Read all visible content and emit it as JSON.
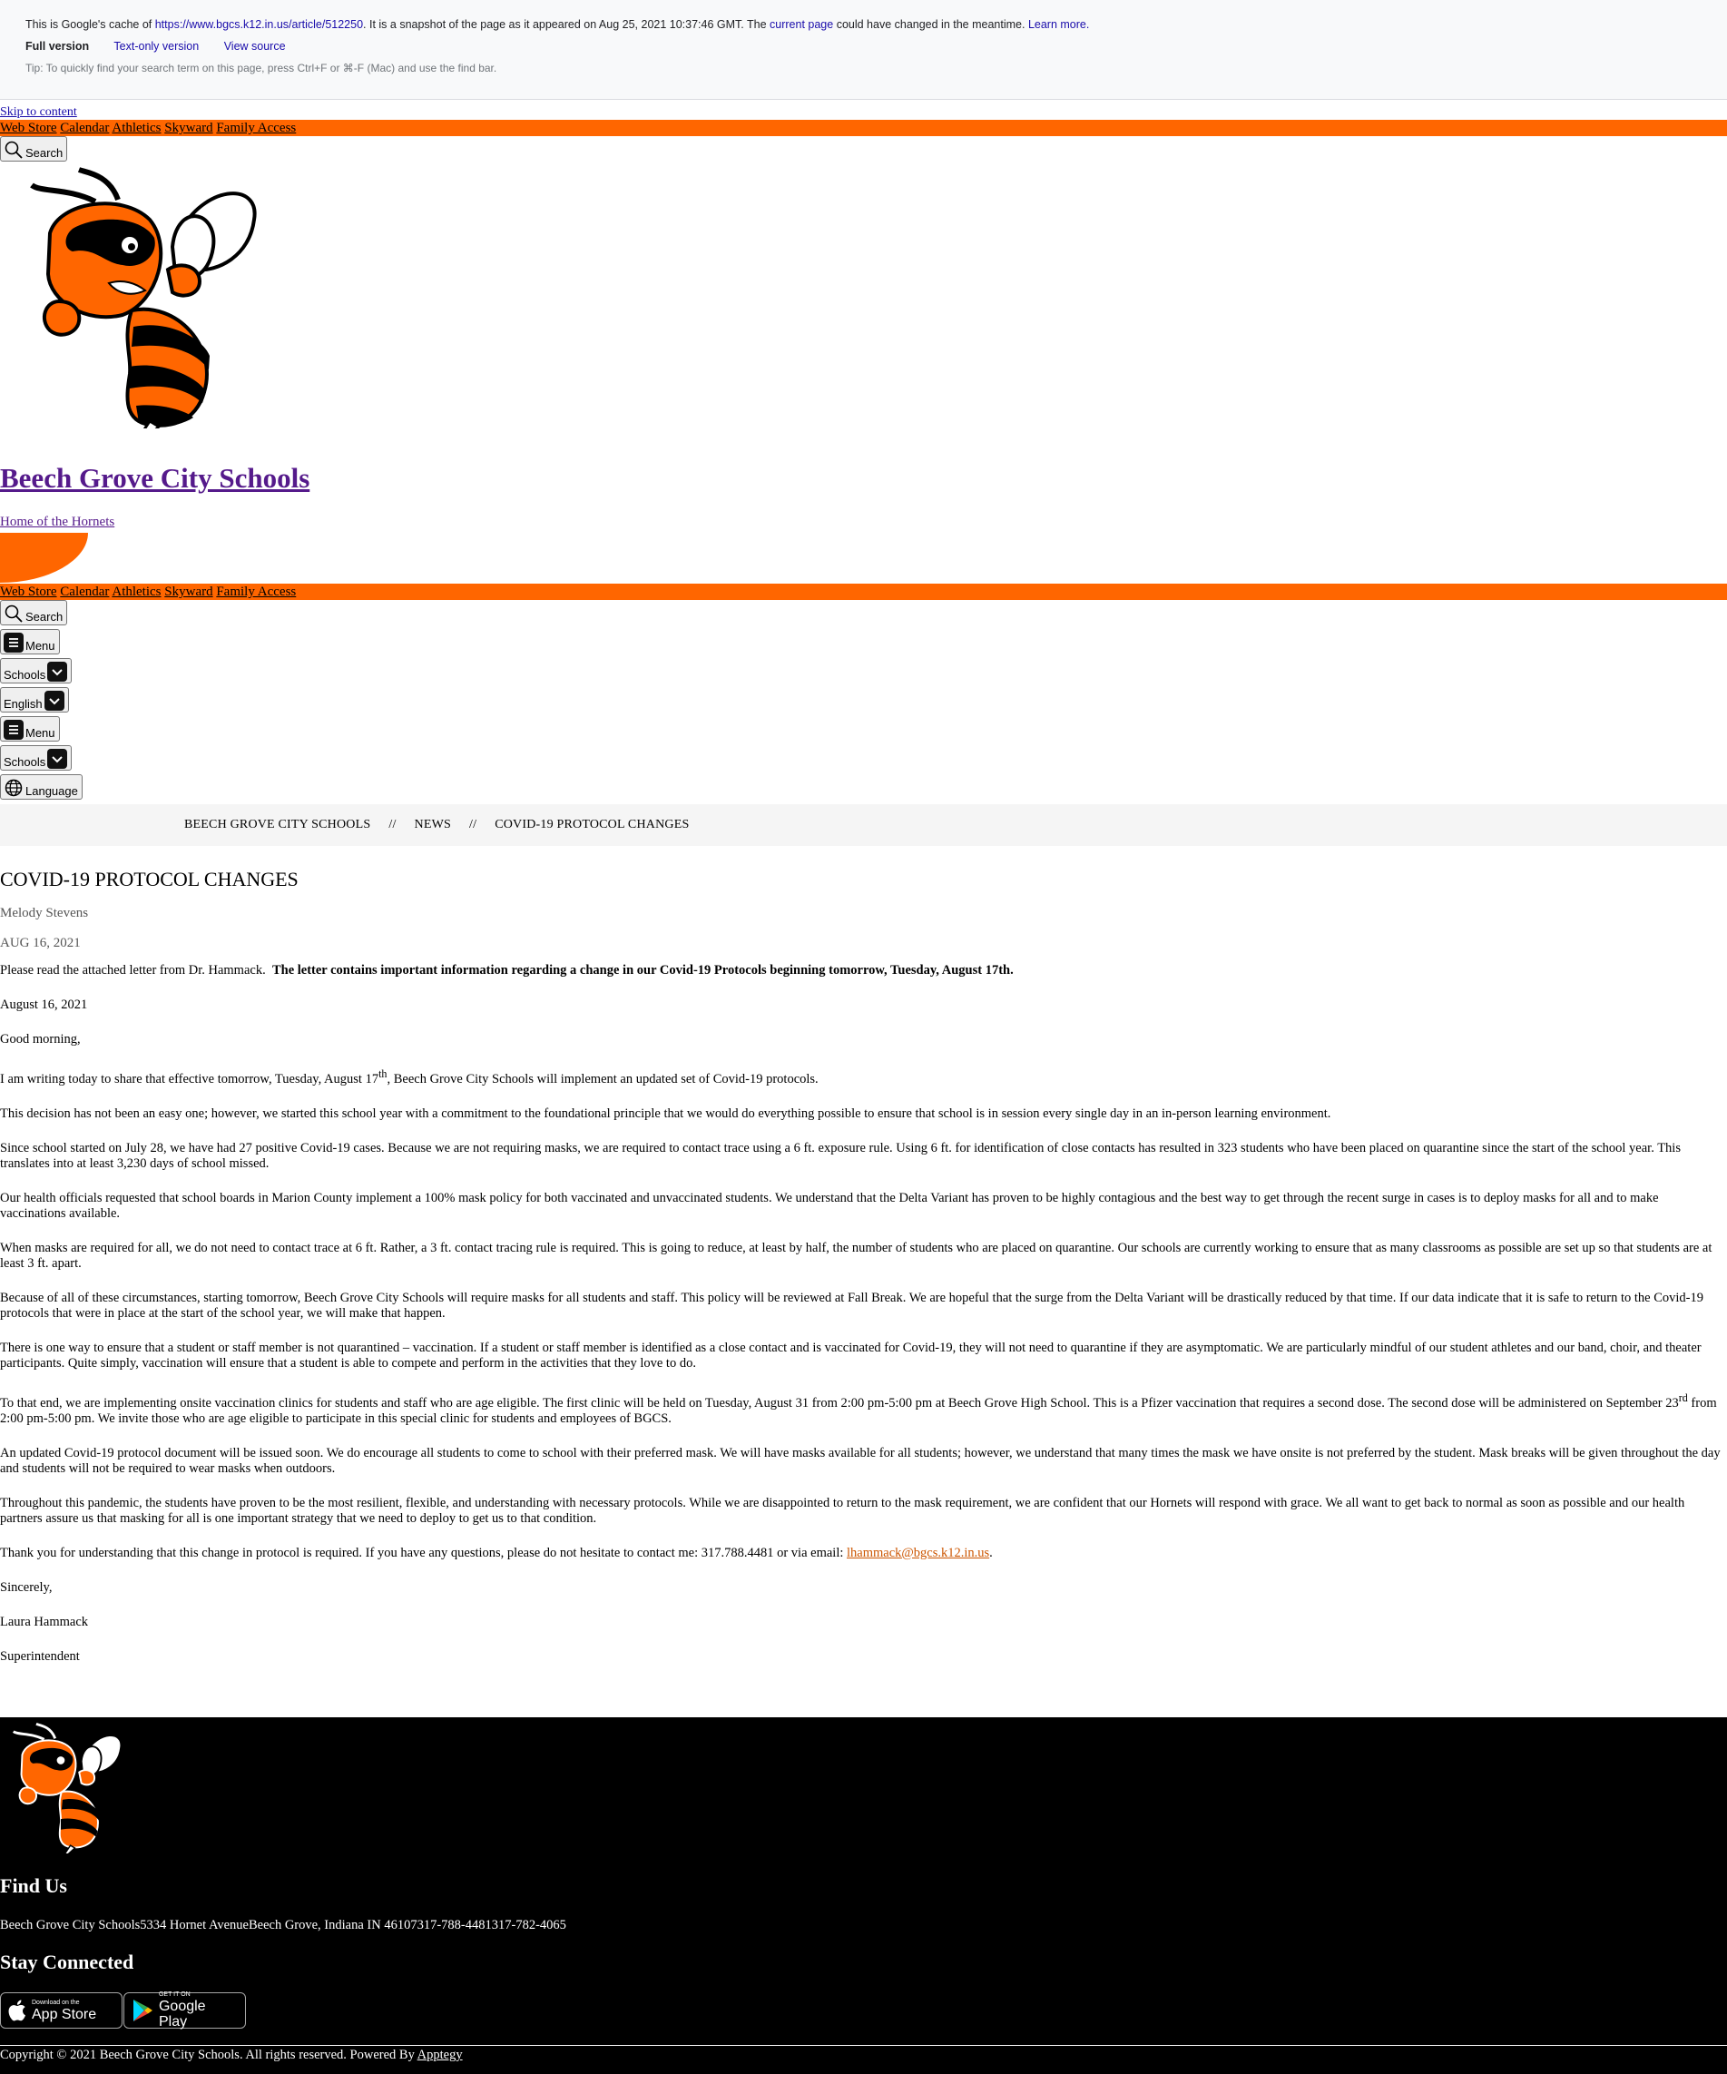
{
  "cache_banner": {
    "prefix": "This is Google's cache of ",
    "url": "https://www.bgcs.k12.in.us/article/512250",
    "mid": ". It is a snapshot of the page as it appeared on Aug 25, 2021 10:37:46 GMT. The ",
    "current_page": "current page",
    "suffix": " could have changed in the meantime. ",
    "learn_more": "Learn more.",
    "full_version": "Full version",
    "text_only": "Text-only version",
    "view_source": "View source",
    "tip": "Tip: To quickly find your search term on this page, press Ctrl+F or ⌘-F (Mac) and use the find bar."
  },
  "skip_link": "Skip to content",
  "top_nav": [
    "Web Store",
    "Calendar",
    "Athletics",
    "Skyward",
    "Family Access"
  ],
  "buttons": {
    "search": "Search",
    "menu": "Menu",
    "schools": "Schools",
    "english": "English",
    "language": "Language"
  },
  "site": {
    "title": "Beech Grove City Schools",
    "tagline": "Home of the Hornets"
  },
  "breadcrumb": [
    "BEECH GROVE CITY SCHOOLS",
    "NEWS",
    "COVID-19 PROTOCOL CHANGES"
  ],
  "breadcrumb_sep": "//",
  "article": {
    "title": "COVID-19 PROTOCOL CHANGES",
    "author": "Melody Stevens",
    "date": "AUG 16, 2021",
    "intro": "Please read the attached letter from Dr. Hammack.",
    "intro_bold": "The letter contains important information regarding a change in our Covid-19 Protocols beginning tomorrow, Tuesday, August 17th.",
    "letter_date": "August 16, 2021",
    "greeting": "Good morning,",
    "p1_a": "I am writing today to share that effective tomorrow, Tuesday, August 17",
    "p1_sup": "th",
    "p1_b": ", Beech Grove City Schools will implement an updated set of Covid-19 protocols.",
    "p2": "This decision has not been an easy one; however, we started this school year with a commitment to the foundational principle that we would do everything possible to ensure that school is in session every single day in an in-person learning environment.",
    "p3": "Since school started on July 28, we have had 27 positive Covid-19 cases.  Because we are not requiring masks, we are required to contact trace using a 6 ft. exposure rule.  Using 6 ft. for identification of close contacts has resulted in 323 students who have been placed on quarantine since the start of the school year.  This translates into at least 3,230 days of school missed.",
    "p4": "Our health officials requested that school boards in Marion County implement a 100% mask policy for both vaccinated and unvaccinated students.  We understand that the Delta Variant has proven to be highly contagious and the best way to get through the recent surge in cases is to deploy masks for all and to make vaccinations available.",
    "p5": "When masks are required for all, we do not need to contact trace at 6 ft.  Rather, a 3 ft. contact tracing rule is required.  This is going to reduce, at least by half, the number of students who are placed on quarantine.  Our schools are currently working to ensure that as many classrooms as possible are set up so that students are at least 3 ft. apart.",
    "p6": "Because of all of these circumstances, starting tomorrow, Beech Grove City Schools will require masks for all students and staff.  This policy will be reviewed at Fall Break.  We are hopeful that the surge from the Delta Variant will be drastically reduced by that time.  If our data indicate that it is safe to return to the Covid-19 protocols that were in place at the start of the school year, we will make that happen.",
    "p7": "There is one way to ensure that a student or staff member is not quarantined – vaccination. If a student or staff member is identified as a close contact and is vaccinated for Covid-19, they will not need to quarantine if they are asymptomatic.  We are particularly mindful of our student athletes and our band, choir, and theater participants.  Quite simply, vaccination will ensure that a student is able to compete and perform in the activities that they love to do.",
    "p8_a": "To that end, we are implementing onsite vaccination clinics for students and staff who are age eligible.  The first clinic will be held on Tuesday, August 31 from 2:00 pm-5:00 pm at Beech Grove High School.  This is a Pfizer vaccination that requires a second dose.  The second dose will be administered on September 23",
    "p8_sup": "rd",
    "p8_b": " from 2:00 pm-5:00 pm.  We invite those who are age eligible to participate in this special clinic for students and employees of BGCS.",
    "p9": "An updated Covid-19 protocol document will be issued soon.  We do encourage all students to come to school with their preferred mask.  We will have masks available for all students; however, we understand that many times the mask we have onsite is not preferred by the student.   Mask breaks will be given throughout the day and students will not be required to wear masks when outdoors.",
    "p10": "Throughout this pandemic, the students have proven to be the most resilient, flexible, and understanding with necessary protocols.  While we are disappointed to return to the mask requirement, we are confident that our Hornets will respond with grace.  We all want to get back to normal as soon as possible and our health partners assure us that masking for all is one important strategy that we need to deploy to get us to that condition.",
    "p11": "Thank you for understanding that this change in protocol is required.  If you have any questions, please do not hesitate to contact me:  317.788.4481 or via email:  ",
    "email": "lhammack@bgcs.k12.in.us",
    "p11_end": ".",
    "closing": "Sincerely,",
    "signature": "Laura Hammack",
    "role": "Superintendent"
  },
  "footer": {
    "find_us": "Find Us",
    "address": "Beech Grove City Schools5334 Hornet AvenueBeech Grove, Indiana IN 46107317-788-4481317-782-4065",
    "stay_connected": "Stay Connected",
    "app_store_small": "Download on the",
    "app_store_big": "App Store",
    "google_play_small": "GET IT ON",
    "google_play_big": "Google Play",
    "copyright": "Copyright © 2021 Beech Grove City Schools. All rights reserved. Powered By ",
    "apptegy": "Apptegy"
  },
  "colors": {
    "brand_orange": "#ff6600",
    "footer_bg": "#000000",
    "link_purple": "#551a8b",
    "email_orange": "#cc5500"
  }
}
